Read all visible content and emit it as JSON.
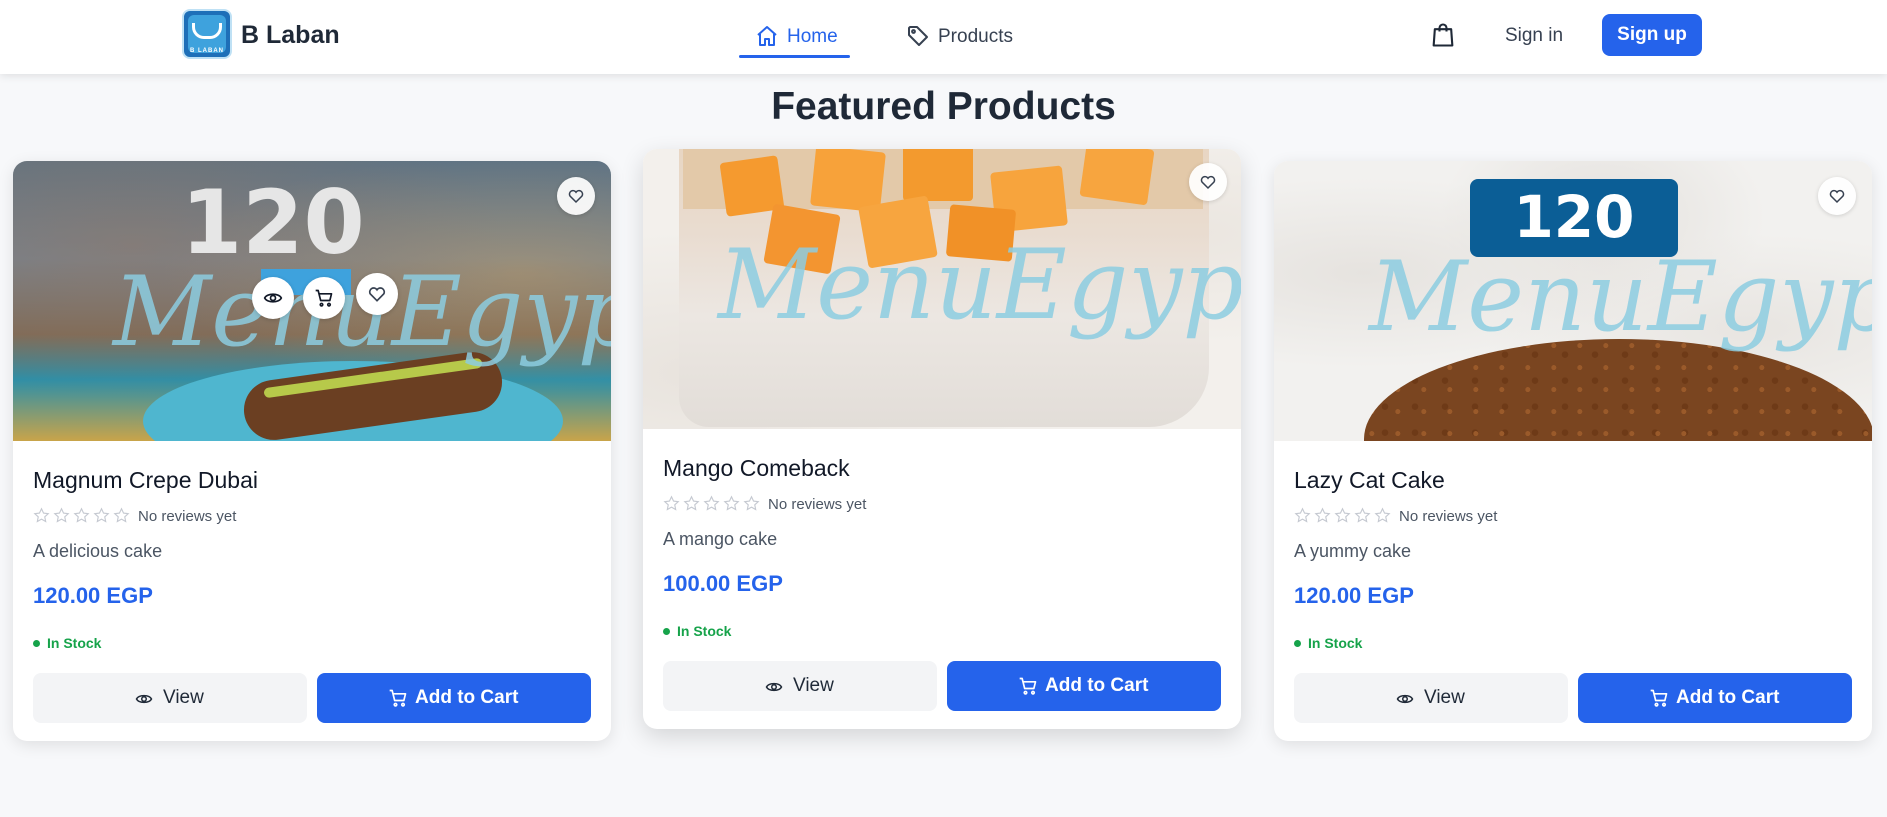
{
  "header": {
    "logo_mini_text": "B LABAN",
    "brand": "B Laban",
    "nav": [
      {
        "label": "Home",
        "icon": "home-icon",
        "active": true
      },
      {
        "label": "Products",
        "icon": "tag-icon",
        "active": false
      }
    ],
    "cart_icon": "shopping-bag-icon",
    "sign_in": "Sign in",
    "sign_up": "Sign up"
  },
  "section_title": "Featured Products",
  "colors": {
    "accent": "#2563eb",
    "in_stock": "#16a34a",
    "background": "#f7f8fa"
  },
  "products": [
    {
      "name": "Magnum Crepe Dubai",
      "image_number": "120",
      "watermark": "MenuEgypt.com",
      "rating_text": "No reviews yet",
      "rating_stars": 0,
      "description": "A delicious cake",
      "price": "120.00 EGP",
      "stock": "In Stock",
      "view_label": "View",
      "cart_label": "Add to Cart"
    },
    {
      "name": "Mango Comeback",
      "image_number": "",
      "watermark": "MenuEgypt.com",
      "rating_text": "No reviews yet",
      "rating_stars": 0,
      "description": "A mango cake",
      "price": "100.00 EGP",
      "stock": "In Stock",
      "view_label": "View",
      "cart_label": "Add to Cart"
    },
    {
      "name": "Lazy Cat Cake",
      "image_number": "120",
      "watermark": "MenuEgypt.com",
      "rating_text": "No reviews yet",
      "rating_stars": 0,
      "description": "A yummy cake",
      "price": "120.00 EGP",
      "stock": "In Stock",
      "view_label": "View",
      "cart_label": "Add to Cart"
    }
  ]
}
